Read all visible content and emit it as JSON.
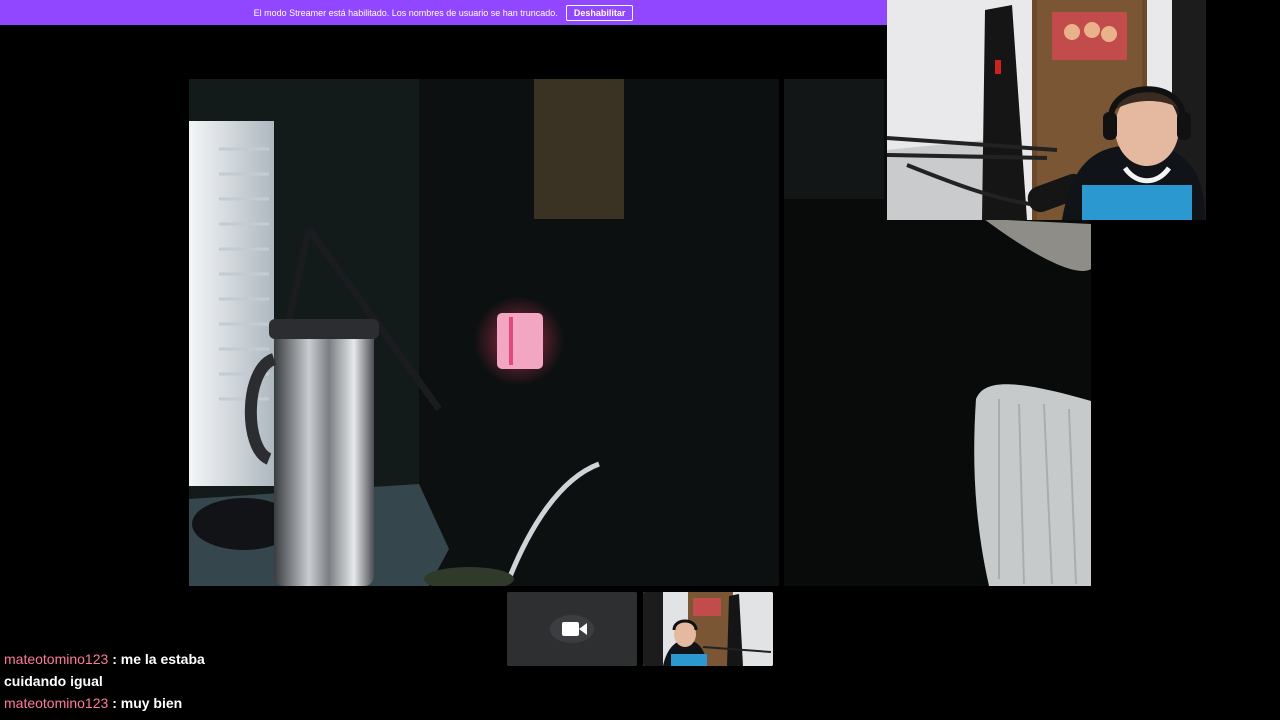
{
  "banner": {
    "text": "El modo Streamer está habilitado. Los nombres de usuario se han truncado.",
    "button_label": "Deshabilitar",
    "color": "#9147ff"
  },
  "chat": {
    "messages": [
      {
        "user": "mateotomino123",
        "separator": ":",
        "text": "me la estaba cuidando igual"
      },
      {
        "user": "mateotomino123",
        "separator": ":",
        "text": "muy bien"
      }
    ],
    "username_color": "#ff7a9a"
  },
  "thumbnails": [
    {
      "icon": "video-camera-icon"
    },
    {
      "icon": "streamer-cam-thumbnail"
    }
  ]
}
